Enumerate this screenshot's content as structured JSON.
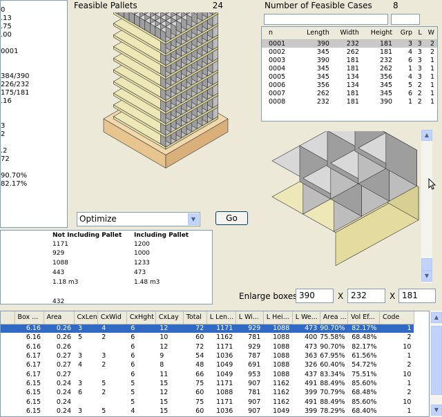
{
  "header": {
    "feasible_pallets_label": "Feasible Pallets",
    "feasible_pallets_value": "24",
    "feasible_cases_label": "Number of Feasible Cases",
    "feasible_cases_value": "8"
  },
  "left_panel_values": [
    "0",
    ".13",
    ".75",
    ".00",
    "",
    "0001",
    "",
    "",
    "384/390",
    "226/232",
    "175/181",
    ".16",
    "",
    "",
    "3",
    "2",
    "",
    ".2",
    "72",
    "",
    "90.70%",
    "82.17%"
  ],
  "cases_table": {
    "columns": [
      "n",
      "Length",
      "Width",
      "Height",
      "Grp",
      "L",
      "W"
    ],
    "rows": [
      [
        "0001",
        "390",
        "232",
        "181",
        "3",
        "3",
        "2"
      ],
      [
        "0002",
        "345",
        "262",
        "181",
        "4",
        "3",
        "2"
      ],
      [
        "0003",
        "390",
        "181",
        "232",
        "6",
        "3",
        "1"
      ],
      [
        "0004",
        "345",
        "181",
        "262",
        "1",
        "3",
        "1"
      ],
      [
        "0005",
        "345",
        "134",
        "356",
        "4",
        "3",
        "1"
      ],
      [
        "0006",
        "356",
        "134",
        "345",
        "5",
        "2",
        "1"
      ],
      [
        "0007",
        "262",
        "181",
        "345",
        "6",
        "2",
        "1"
      ],
      [
        "0008",
        "232",
        "181",
        "390",
        "1",
        "2",
        "1"
      ]
    ]
  },
  "controls": {
    "optimize_value": "Optimize",
    "go_label": "Go",
    "enlarge_label": "Enlarge boxes",
    "enlarge_length": "390",
    "enlarge_width": "232",
    "enlarge_height": "181",
    "x_symbol": "X"
  },
  "summary": {
    "col1_header": "Not Including Pallet",
    "col2_header": "Including Pallet",
    "col1": [
      "1171",
      "929",
      "1088",
      "443",
      "1.18 m3",
      "",
      "432"
    ],
    "col2": [
      "1200",
      "1000",
      "1233",
      "473",
      "1.48 m3"
    ]
  },
  "results_table": {
    "columns": [
      "",
      "Box ...",
      "Area",
      "CxLen",
      "CxWid",
      "CxHght",
      "CxLay",
      "Total",
      "L Len...",
      "L Wi...",
      "L Hei...",
      "L We...",
      "Area ...",
      "Vol Ef...",
      "Code"
    ],
    "rows": [
      [
        "",
        "6.16",
        "0.26",
        "3",
        "4",
        "6",
        "12",
        "72",
        "1171",
        "929",
        "1088",
        "473",
        "90.70%",
        "82.17%",
        "1"
      ],
      [
        "",
        "6.16",
        "0.26",
        "5",
        "2",
        "6",
        "10",
        "60",
        "1162",
        "781",
        "1088",
        "400",
        "75.58%",
        "68.48%",
        "2"
      ],
      [
        "",
        "6.16",
        "0.26",
        "",
        "",
        "6",
        "12",
        "72",
        "1171",
        "929",
        "1088",
        "473",
        "90.70%",
        "82.17%",
        "10"
      ],
      [
        "",
        "6.17",
        "0.27",
        "3",
        "3",
        "6",
        "9",
        "54",
        "1036",
        "787",
        "1088",
        "363",
        "67.95%",
        "61.56%",
        "1"
      ],
      [
        "",
        "6.17",
        "0.27",
        "4",
        "2",
        "6",
        "8",
        "48",
        "1049",
        "691",
        "1088",
        "326",
        "60.40%",
        "54.72%",
        "2"
      ],
      [
        "",
        "6.17",
        "0.27",
        "",
        "",
        "6",
        "11",
        "66",
        "1049",
        "953",
        "1088",
        "437",
        "83.34%",
        "75.51%",
        "10"
      ],
      [
        "",
        "6.15",
        "0.24",
        "3",
        "5",
        "5",
        "15",
        "75",
        "1171",
        "907",
        "1162",
        "491",
        "88.49%",
        "85.60%",
        "1"
      ],
      [
        "",
        "6.15",
        "0.24",
        "6",
        "2",
        "5",
        "12",
        "60",
        "1088",
        "781",
        "1162",
        "399",
        "70.79%",
        "68.48%",
        "2"
      ],
      [
        "",
        "6.15",
        "0.24",
        "",
        "",
        "5",
        "15",
        "75",
        "1171",
        "907",
        "1162",
        "491",
        "88.49%",
        "85.60%",
        "10"
      ],
      [
        "",
        "6.15",
        "0.24",
        "3",
        "5",
        "4",
        "15",
        "60",
        "1036",
        "907",
        "1049",
        "399",
        "78.29%",
        "68.40%",
        "1"
      ]
    ]
  },
  "colors": {
    "selection_blue": "#316ac5",
    "case_top": "#d8d8d8",
    "case_side": "#bdbdbd",
    "case_front": "#9e9e9e",
    "slip_sheet": "#eee8b8",
    "pallet_wood": "#f2d9ad"
  },
  "icons": {
    "dropdown": "chevron-down-icon",
    "scroll_up": "chevron-up-icon",
    "scroll_down": "chevron-down-icon",
    "cursor": "mouse-pointer-icon"
  }
}
